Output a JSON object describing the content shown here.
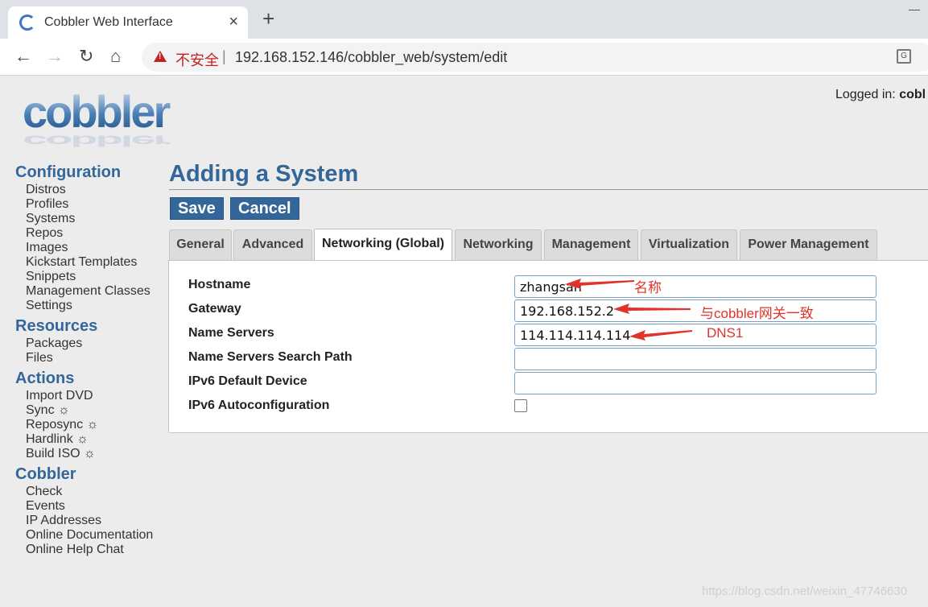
{
  "browser": {
    "tab_title": "Cobbler Web Interface",
    "tab_close": "×",
    "new_tab": "+",
    "back": "←",
    "forward": "→",
    "reload": "↻",
    "home": "⌂",
    "insecure_label": "不安全",
    "separator": "|",
    "url": "192.168.152.146/cobbler_web/system/edit",
    "icons": {
      "favicon": "cobbler-favicon-icon",
      "warning": "warning-icon",
      "translate": "translate-icon"
    }
  },
  "header": {
    "logged_in_label": "Logged in:",
    "logged_in_user": "cobl"
  },
  "sidebar": {
    "sections": [
      {
        "heading": "Configuration",
        "items": [
          "Distros",
          "Profiles",
          "Systems",
          "Repos",
          "Images",
          "Kickstart Templates",
          "Snippets",
          "Management Classes",
          "Settings"
        ]
      },
      {
        "heading": "Resources",
        "items": [
          "Packages",
          "Files"
        ]
      },
      {
        "heading": "Actions",
        "items": [
          "Import DVD",
          "Sync ☼",
          "Reposync ☼",
          "Hardlink ☼",
          "Build ISO ☼"
        ]
      },
      {
        "heading": "Cobbler",
        "items": [
          "Check",
          "Events",
          "IP Addresses",
          "Online Documentation",
          "Online Help Chat"
        ]
      }
    ]
  },
  "main": {
    "title": "Adding a System",
    "save_label": "Save",
    "cancel_label": "Cancel",
    "tabs": [
      "General",
      "Advanced",
      "Networking (Global)",
      "Networking",
      "Management",
      "Virtualization",
      "Power Management"
    ],
    "active_tab": "Networking (Global)",
    "fields": [
      {
        "label": "Hostname",
        "value": "zhangsan"
      },
      {
        "label": "Gateway",
        "value": "192.168.152.2"
      },
      {
        "label": "Name Servers",
        "value": "114.114.114.114"
      },
      {
        "label": "Name Servers Search Path",
        "value": ""
      },
      {
        "label": "IPv6 Default Device",
        "value": ""
      }
    ],
    "checkbox_field": {
      "label": "IPv6 Autoconfiguration",
      "checked": false
    }
  },
  "annotations": {
    "hostname_note": "名称",
    "gateway_note": "与cobbler网关一致",
    "dns_note": "DNS1",
    "color": "#e0332b"
  },
  "watermark": "https://blog.csdn.net/weixin_47746630",
  "colors": {
    "accent": "#336699",
    "tabstrip": "#dee1e6"
  }
}
